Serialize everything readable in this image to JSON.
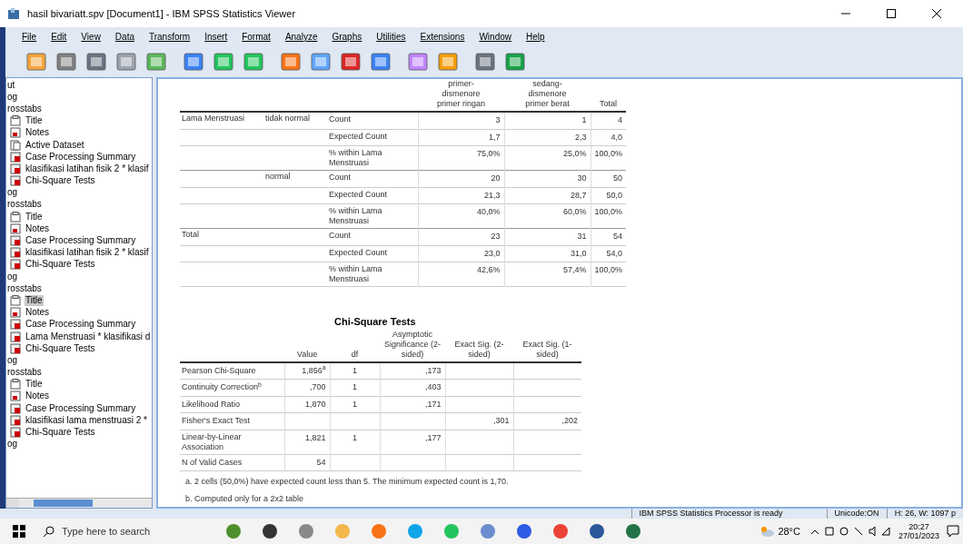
{
  "window": {
    "title": "hasil bivariatt.spv [Document1] - IBM SPSS Statistics Viewer"
  },
  "menu": [
    "File",
    "Edit",
    "View",
    "Data",
    "Transform",
    "Insert",
    "Format",
    "Analyze",
    "Graphs",
    "Utilities",
    "Extensions",
    "Window",
    "Help"
  ],
  "outline": [
    {
      "label": "ut",
      "kind": "text",
      "selected": false,
      "children": [
        {
          "label": "og",
          "kind": "text",
          "selected": false
        },
        {
          "label": "rosstabs",
          "kind": "text",
          "selected": false,
          "children": [
            {
              "label": "Title",
              "kind": "title",
              "selected": false
            },
            {
              "label": "Notes",
              "kind": "notes",
              "selected": false
            },
            {
              "label": "Active Dataset",
              "kind": "dataset",
              "selected": false
            },
            {
              "label": "Case Processing Summary",
              "kind": "table",
              "selected": false
            },
            {
              "label": "klasifikasi latihan fisik 2  * klasif",
              "kind": "table",
              "selected": false
            },
            {
              "label": "Chi-Square Tests",
              "kind": "table",
              "selected": false
            }
          ]
        },
        {
          "label": "og",
          "kind": "text",
          "selected": false
        },
        {
          "label": "rosstabs",
          "kind": "text",
          "selected": false,
          "children": [
            {
              "label": "Title",
              "kind": "title",
              "selected": false
            },
            {
              "label": "Notes",
              "kind": "notes",
              "selected": false
            },
            {
              "label": "Case Processing Summary",
              "kind": "table",
              "selected": false
            },
            {
              "label": "klasifikasi latihan fisik 2  * klasif",
              "kind": "table",
              "selected": false
            },
            {
              "label": "Chi-Square Tests",
              "kind": "table",
              "selected": false
            }
          ]
        },
        {
          "label": "og",
          "kind": "text",
          "selected": false
        },
        {
          "label": "rosstabs",
          "kind": "text",
          "selected": false,
          "children": [
            {
              "label": "Title",
              "kind": "title",
              "selected": true
            },
            {
              "label": "Notes",
              "kind": "notes",
              "selected": false
            },
            {
              "label": "Case Processing Summary",
              "kind": "table",
              "selected": false
            },
            {
              "label": "Lama Menstruasi * klasifikasi d",
              "kind": "table",
              "selected": false
            },
            {
              "label": "Chi-Square Tests",
              "kind": "table",
              "selected": false
            }
          ]
        },
        {
          "label": "og",
          "kind": "text",
          "selected": false
        },
        {
          "label": "rosstabs",
          "kind": "text",
          "selected": false,
          "children": [
            {
              "label": "Title",
              "kind": "title",
              "selected": false
            },
            {
              "label": "Notes",
              "kind": "notes",
              "selected": false
            },
            {
              "label": "Case Processing Summary",
              "kind": "table",
              "selected": false
            },
            {
              "label": "klasifikasi lama menstruasi 2  *",
              "kind": "table",
              "selected": false
            },
            {
              "label": "Chi-Square Tests",
              "kind": "table",
              "selected": false
            }
          ]
        },
        {
          "label": "og",
          "kind": "text",
          "selected": false
        }
      ]
    }
  ],
  "crosstab": {
    "columns": [
      "primer-\ndismenore\nprimer ringan",
      "sedang-\ndismenore\nprimer berat",
      "Total"
    ],
    "rows": [
      {
        "group": "Lama Menstruasi",
        "sub": "tidak normal",
        "stat": "Count",
        "values": [
          "3",
          "1",
          "4"
        ]
      },
      {
        "stat": "Expected Count",
        "values": [
          "1,7",
          "2,3",
          "4,0"
        ]
      },
      {
        "stat": "% within Lama Menstruasi",
        "values": [
          "75,0%",
          "25,0%",
          "100,0%"
        ]
      },
      {
        "sub": "normal",
        "stat": "Count",
        "values": [
          "20",
          "30",
          "50"
        ]
      },
      {
        "stat": "Expected Count",
        "values": [
          "21,3",
          "28,7",
          "50,0"
        ]
      },
      {
        "stat": "% within Lama Menstruasi",
        "values": [
          "40,0%",
          "60,0%",
          "100,0%"
        ]
      },
      {
        "group": "Total",
        "stat": "Count",
        "values": [
          "23",
          "31",
          "54"
        ]
      },
      {
        "stat": "Expected Count",
        "values": [
          "23,0",
          "31,0",
          "54,0"
        ]
      },
      {
        "stat": "% within Lama Menstruasi",
        "values": [
          "42,6%",
          "57,4%",
          "100,0%"
        ]
      }
    ]
  },
  "chi_square": {
    "title": "Chi-Square Tests",
    "columns": [
      "Value",
      "df",
      "Asymptotic Significance (2-sided)",
      "Exact Sig. (2-sided)",
      "Exact Sig. (1-sided)"
    ],
    "rows": [
      {
        "label": "Pearson Chi-Square",
        "value": "1,856$^{a}$",
        "df": "1",
        "asymp_sig": ",173"
      },
      {
        "label": "Continuity Correction$^{b}$",
        "value": ",700",
        "df": "1",
        "asymp_sig": ",403"
      },
      {
        "label": "Likelihood Ratio",
        "value": "1,870",
        "df": "1",
        "asymp_sig": ",171"
      },
      {
        "label": "Fisher's Exact Test",
        "exact_sig_2": ",301",
        "exact_sig_1": ",202"
      },
      {
        "label": "Linear-by-Linear Association",
        "value": "1,821",
        "df": "1",
        "asymp_sig": ",177"
      },
      {
        "label": "N of Valid Cases",
        "value": "54"
      }
    ],
    "footnotes": [
      "a. 2 cells (50,0%) have expected count less than 5. The minimum expected count is 1,70.",
      "b. Computed only for a 2x2 table"
    ]
  },
  "status_bar": [
    "IBM SPSS Statistics Processor is ready",
    "Unicode:ON",
    "H: 26, W: 1097 p"
  ],
  "taskbar": {
    "search_placeholder": "Type here to search",
    "weather": "28°C",
    "time": "20:27",
    "date": "27/01/2023"
  }
}
